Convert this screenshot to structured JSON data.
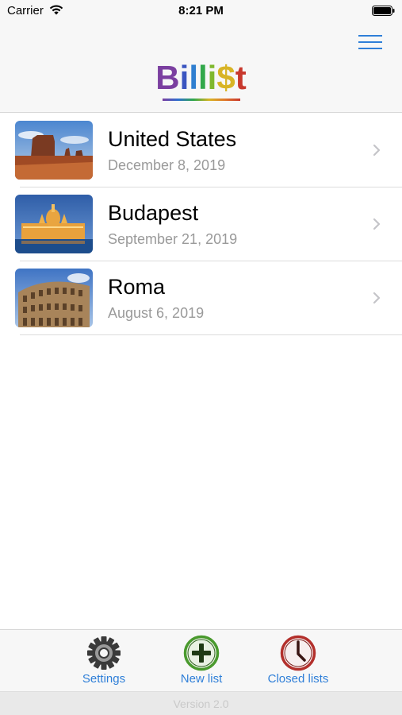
{
  "status_bar": {
    "carrier": "Carrier",
    "time": "8:21 PM"
  },
  "nav": {
    "logo_text": [
      "B",
      "i",
      "l",
      "l",
      "i",
      "$",
      "t"
    ],
    "logo_colors": [
      "#7b3fa0",
      "#3a55c0",
      "#2f7fd0",
      "#32a84b",
      "#7fb82e",
      "#d8b425",
      "#c8382d"
    ],
    "menu_icon": "hamburger-menu-icon"
  },
  "lists": [
    {
      "title": "United States",
      "date": "December 8, 2019",
      "image": "monument-valley"
    },
    {
      "title": "Budapest",
      "date": "September 21, 2019",
      "image": "parliament-night"
    },
    {
      "title": "Roma",
      "date": "August 6, 2019",
      "image": "colosseum"
    }
  ],
  "tab_bar": {
    "items": [
      {
        "label": "Settings",
        "icon": "gear-icon"
      },
      {
        "label": "New list",
        "icon": "plus-circle-icon"
      },
      {
        "label": "Closed lists",
        "icon": "clock-icon"
      }
    ],
    "version": "Version 2.0"
  },
  "colors": {
    "accent": "#2f7fd8",
    "new_list_green": "#4a9a2e",
    "closed_red": "#b3302c"
  }
}
